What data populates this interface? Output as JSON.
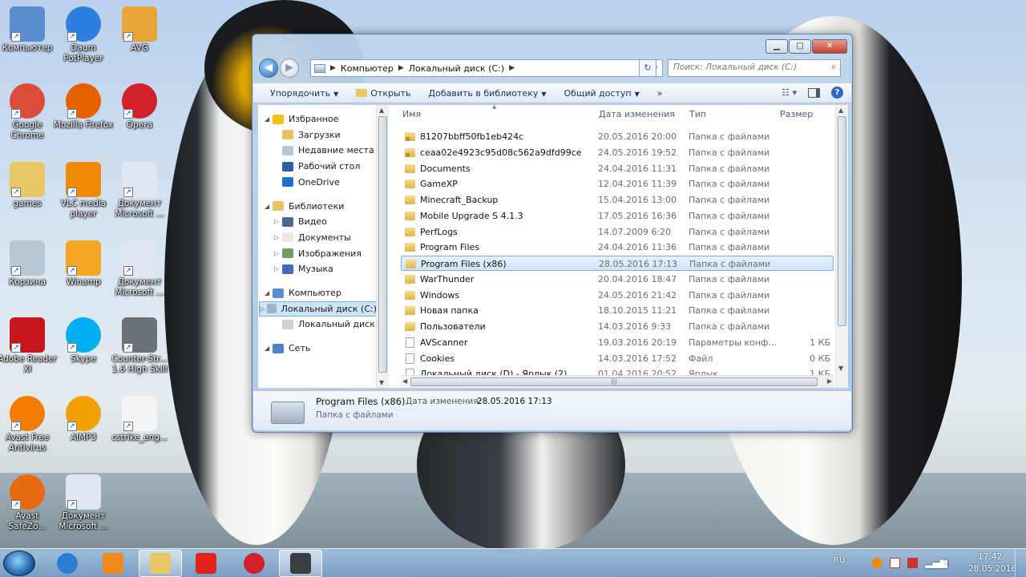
{
  "desktop": {
    "icons": [
      {
        "label": "Компьютер",
        "icon": "computer-icon",
        "color": "#5b8fd0"
      },
      {
        "label": "Daum PotPlayer",
        "icon": "potplayer-icon",
        "color": "#2d7fe0"
      },
      {
        "label": "AVG",
        "icon": "avg-icon",
        "color": "#e8a33a"
      },
      {
        "label": "Google Chrome",
        "icon": "chrome-icon",
        "color": "#dd4b39"
      },
      {
        "label": "Mozilla Firefox",
        "icon": "firefox-icon",
        "color": "#e66000"
      },
      {
        "label": "Opera",
        "icon": "opera-icon",
        "color": "#d0212c"
      },
      {
        "label": "games",
        "icon": "folder-icon",
        "color": "#e8c866"
      },
      {
        "label": "VLC media player",
        "icon": "vlc-icon",
        "color": "#f08a00"
      },
      {
        "label": "Документ Microsoft ...",
        "icon": "document-icon",
        "color": "#dfe6ef"
      },
      {
        "label": "Корзина",
        "icon": "recycle-bin-icon",
        "color": "#b8c6d6"
      },
      {
        "label": "Winamp",
        "icon": "winamp-icon",
        "color": "#f5a623"
      },
      {
        "label": "Документ Microsoft ...",
        "icon": "document-icon",
        "color": "#dfe6ef"
      },
      {
        "label": "Adobe Reader XI",
        "icon": "adobe-reader-icon",
        "color": "#c4161c"
      },
      {
        "label": "Skype",
        "icon": "skype-icon",
        "color": "#00aff0"
      },
      {
        "label": "Counter-Str... 1.6 High Skill",
        "icon": "counter-strike-icon",
        "color": "#6c7378"
      },
      {
        "label": "Avast Free Antivirus",
        "icon": "avast-icon",
        "color": "#f27c00"
      },
      {
        "label": "AIMP3",
        "icon": "aimp-icon",
        "color": "#f29f05"
      },
      {
        "label": "cstrike_eng...",
        "icon": "file-icon",
        "color": "#f4f4f4"
      },
      {
        "label": "Avast SafeZo...",
        "icon": "avast-safezone-icon",
        "color": "#e86a10"
      },
      {
        "label": "Документ Microsoft ...",
        "icon": "document-icon",
        "color": "#dfe6ef"
      }
    ]
  },
  "window": {
    "breadcrumb": [
      "Компьютер",
      "Локальный диск (C:)"
    ],
    "search_placeholder": "Поиск: Локальный диск (C:)",
    "toolbar": {
      "organize": "Упорядочить",
      "open": "Открыть",
      "add_library": "Добавить в библиотеку",
      "share": "Общий доступ",
      "more": "»"
    },
    "nav": [
      {
        "label": "Избранное",
        "level": 0,
        "icon": "star-icon",
        "color": "#f0c419"
      },
      {
        "label": "Загрузки",
        "level": 1,
        "icon": "downloads-icon",
        "color": "#e7c567"
      },
      {
        "label": "Недавние места",
        "level": 1,
        "icon": "recent-places-icon",
        "color": "#b9c6d6"
      },
      {
        "label": "Рабочий стол",
        "level": 1,
        "icon": "desktop-icon",
        "color": "#2d5fa6"
      },
      {
        "label": "OneDrive",
        "level": 1,
        "icon": "onedrive-icon",
        "color": "#1f6fd0"
      },
      {
        "label": "",
        "level": -1
      },
      {
        "label": "Библиотеки",
        "level": 0,
        "icon": "libraries-icon",
        "color": "#e7c567"
      },
      {
        "label": "Видео",
        "level": 1,
        "icon": "video-icon",
        "color": "#4a6b8f"
      },
      {
        "label": "Документы",
        "level": 1,
        "icon": "documents-icon",
        "color": "#e8e8e8"
      },
      {
        "label": "Изображения",
        "level": 1,
        "icon": "pictures-icon",
        "color": "#6f9c5f"
      },
      {
        "label": "Музыка",
        "level": 1,
        "icon": "music-icon",
        "color": "#3d6fb8"
      },
      {
        "label": "",
        "level": -1
      },
      {
        "label": "Компьютер",
        "level": 0,
        "icon": "computer-icon",
        "color": "#5b8fd0"
      },
      {
        "label": "Локальный диск (C:)",
        "level": 1,
        "icon": "drive-c-icon",
        "color": "#9fb4c8",
        "selected": true
      },
      {
        "label": "Локальный диск (D:)",
        "level": 1,
        "icon": "drive-d-icon",
        "color": "#c9d2da"
      },
      {
        "label": "",
        "level": -1
      },
      {
        "label": "Сеть",
        "level": 0,
        "icon": "network-icon",
        "color": "#4a82c4"
      }
    ],
    "columns": {
      "name": "Имя",
      "date": "Дата изменения",
      "type": "Тип",
      "size": "Размер"
    },
    "files": [
      {
        "name": "81207bbff50fb1eb424c",
        "date": "20.05.2016 20:00",
        "type": "Папка с файлами",
        "size": "",
        "icon": "locked-folder-icon"
      },
      {
        "name": "ceaa02e4923c95d08c562a9dfd99ce",
        "date": "24.05.2016 19:52",
        "type": "Папка с файлами",
        "size": "",
        "icon": "locked-folder-icon"
      },
      {
        "name": "Documents",
        "date": "24.04.2016 11:31",
        "type": "Папка с файлами",
        "size": "",
        "icon": "folder-icon"
      },
      {
        "name": "GameXP",
        "date": "12.04.2016 11:39",
        "type": "Папка с файлами",
        "size": "",
        "icon": "folder-icon"
      },
      {
        "name": "Minecraft_Backup",
        "date": "15.04.2016 13:00",
        "type": "Папка с файлами",
        "size": "",
        "icon": "folder-icon"
      },
      {
        "name": "Mobile Upgrade S 4.1.3",
        "date": "17.05.2016 16:36",
        "type": "Папка с файлами",
        "size": "",
        "icon": "folder-icon"
      },
      {
        "name": "PerfLogs",
        "date": "14.07.2009 6:20",
        "type": "Папка с файлами",
        "size": "",
        "icon": "folder-icon"
      },
      {
        "name": "Program Files",
        "date": "24.04.2016 11:36",
        "type": "Папка с файлами",
        "size": "",
        "icon": "folder-icon"
      },
      {
        "name": "Program Files (x86)",
        "date": "28.05.2016 17:13",
        "type": "Папка с файлами",
        "size": "",
        "icon": "folder-icon",
        "selected": true
      },
      {
        "name": "WarThunder",
        "date": "20.04.2016 18:47",
        "type": "Папка с файлами",
        "size": "",
        "icon": "folder-icon"
      },
      {
        "name": "Windows",
        "date": "24.05.2016 21:42",
        "type": "Папка с файлами",
        "size": "",
        "icon": "folder-icon"
      },
      {
        "name": "Новая папка",
        "date": "18.10.2015 11:21",
        "type": "Папка с файлами",
        "size": "",
        "icon": "folder-icon"
      },
      {
        "name": "Пользователи",
        "date": "14.03.2016 9:33",
        "type": "Папка с файлами",
        "size": "",
        "icon": "folder-icon"
      },
      {
        "name": "AVScanner",
        "date": "19.03.2016 20:19",
        "type": "Параметры конф...",
        "size": "1 КБ",
        "icon": "settings-file-icon"
      },
      {
        "name": "Cookies",
        "date": "14.03.2016 17:52",
        "type": "Файл",
        "size": "0 КБ",
        "icon": "file-icon"
      },
      {
        "name": "Локальный диск (D) - Ярлык (2)",
        "date": "01.04.2016 20:52",
        "type": "Ярлык",
        "size": "1 КБ",
        "icon": "shortcut-icon"
      }
    ],
    "details": {
      "name": "Program Files (x86)",
      "date_label": "Дата изменения:",
      "date_value": "28.05.2016 17:13",
      "type": "Папка с файлами"
    }
  },
  "taskbar": {
    "apps": [
      {
        "name": "internet-explorer-icon",
        "color": "#2a7fd4",
        "active": false
      },
      {
        "name": "media-player-icon",
        "color": "#f08a1c",
        "active": false
      },
      {
        "name": "explorer-icon",
        "color": "#e8c866",
        "active": true
      },
      {
        "name": "yandex-browser-icon",
        "color": "#e2231a",
        "active": false
      },
      {
        "name": "opera-icon",
        "color": "#d0212c",
        "active": false
      },
      {
        "name": "counter-strike-icon",
        "color": "#3a3f44",
        "active": true
      }
    ],
    "lang": "RU",
    "time": "17:42",
    "date": "28.05.2016"
  }
}
